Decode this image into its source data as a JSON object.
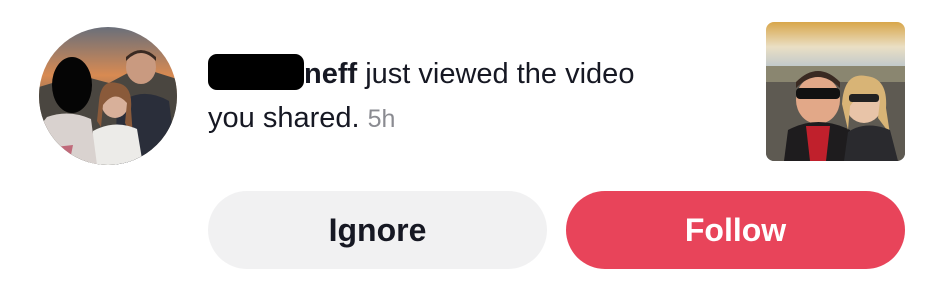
{
  "notification": {
    "username_visible": "neff",
    "message_line1": " just viewed the video",
    "message_line2": "you shared.",
    "time": "5h"
  },
  "actions": {
    "ignore_label": "Ignore",
    "follow_label": "Follow"
  },
  "colors": {
    "follow_button": "#e8445a",
    "ignore_button": "#f1f1f2",
    "time_text": "#8a8b91"
  }
}
